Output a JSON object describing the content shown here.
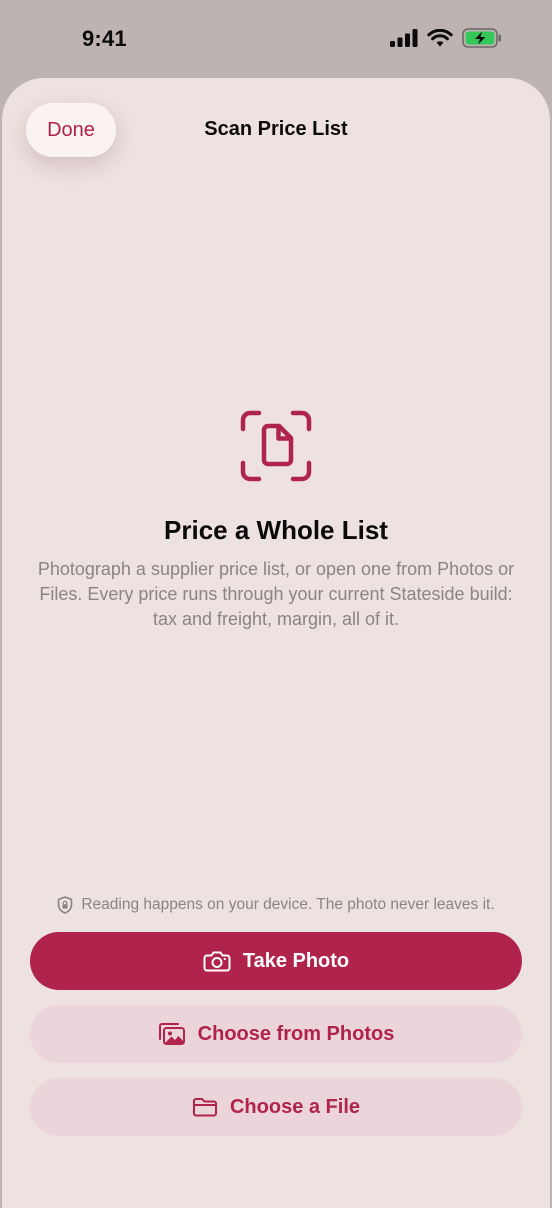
{
  "status_bar": {
    "time": "9:41",
    "icons": [
      "signal-icon",
      "wifi-icon",
      "battery-charging-icon"
    ]
  },
  "nav": {
    "done_label": "Done",
    "title": "Scan Price List"
  },
  "hero": {
    "icon": "document-scan-icon",
    "title": "Price a Whole List",
    "description": "Photograph a supplier price list, or open one from Photos or Files. Every price runs through your current Stateside build: tax and freight, margin, all of it."
  },
  "privacy": {
    "icon": "lock-shield-icon",
    "text": "Reading happens on your device. The photo never leaves it."
  },
  "actions": {
    "take_photo": {
      "label": "Take Photo",
      "icon": "camera-icon"
    },
    "choose_photos": {
      "label": "Choose from Photos",
      "icon": "photos-icon"
    },
    "choose_file": {
      "label": "Choose a File",
      "icon": "folder-icon"
    }
  },
  "colors": {
    "accent": "#b0234b",
    "sheet_background": "#ede2df",
    "secondary_button": "#ecd5da",
    "muted_text": "#8b8483"
  }
}
